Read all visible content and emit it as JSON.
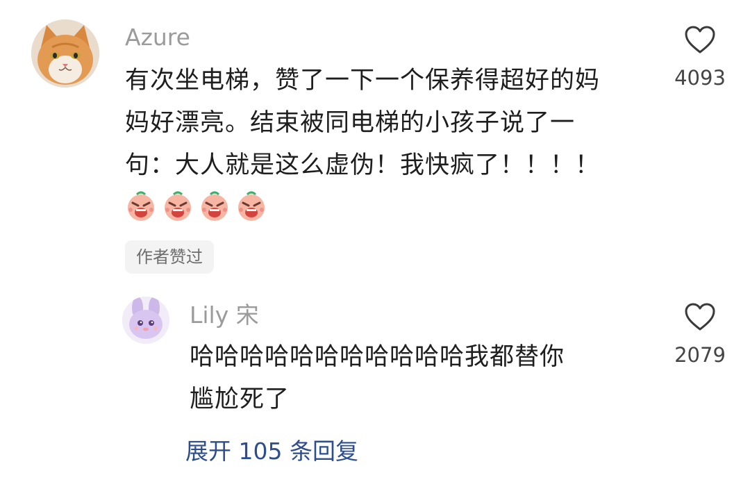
{
  "main_comment": {
    "username": "Azure",
    "text_lines": [
      "有次坐电梯，赞了一下一个保养得超好的妈",
      "妈好漂亮。结束被同电梯的小孩子说了一",
      "句：大人就是这么虚伪！我快疯了！！！！"
    ],
    "emoji_count": 4,
    "emoji_icon": "crying-face-emoji",
    "like_count": "4093",
    "author_liked_tag": "作者赞过"
  },
  "reply": {
    "username": "Lily 宋",
    "text_lines": [
      "哈哈哈哈哈哈哈哈哈哈哈我都替你",
      "尴尬死了"
    ],
    "like_count": "2079"
  },
  "expand_replies": "展开 105 条回复",
  "colors": {
    "username": "#9b9b9b",
    "text": "#1e1e1e",
    "link": "#2d4e8e",
    "tag_bg": "#f3f3f3"
  }
}
